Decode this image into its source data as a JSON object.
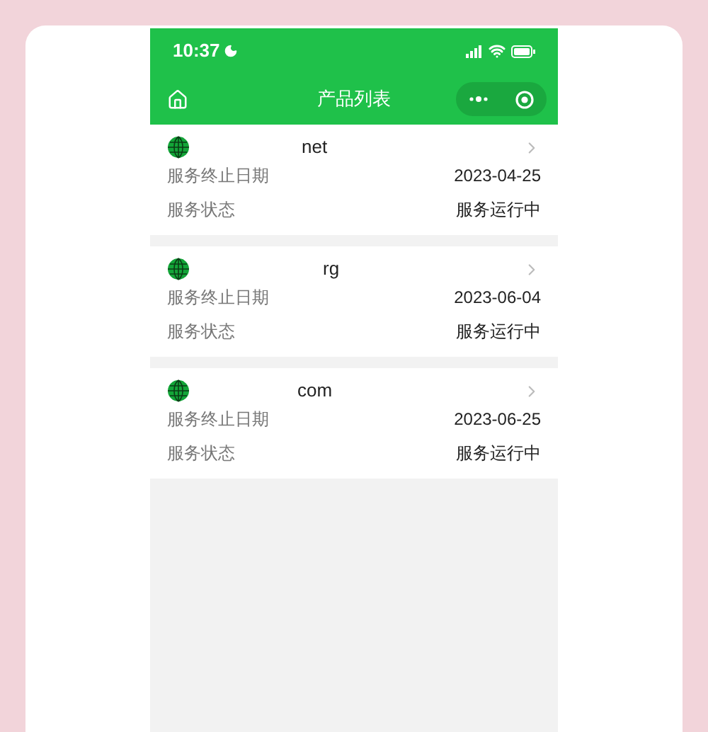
{
  "status_bar": {
    "time": "10:37"
  },
  "nav": {
    "title": "产品列表"
  },
  "products": [
    {
      "domain": "net",
      "rows": [
        {
          "label": "服务终止日期",
          "value": "2023-04-25"
        },
        {
          "label": "服务状态",
          "value": "服务运行中"
        }
      ]
    },
    {
      "domain": "rg",
      "rows": [
        {
          "label": "服务终止日期",
          "value": "2023-06-04"
        },
        {
          "label": "服务状态",
          "value": "服务运行中"
        }
      ]
    },
    {
      "domain": "com",
      "rows": [
        {
          "label": "服务终止日期",
          "value": "2023-06-25"
        },
        {
          "label": "服务状态",
          "value": "服务运行中"
        }
      ]
    }
  ]
}
